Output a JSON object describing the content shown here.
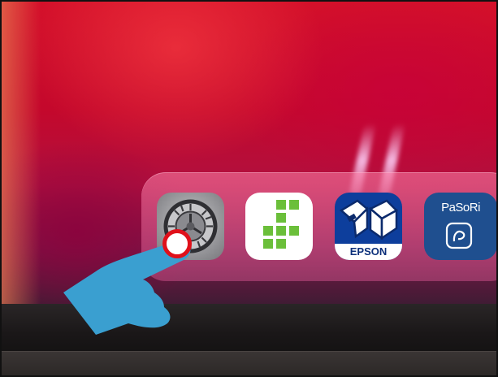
{
  "dock": {
    "apps": [
      {
        "name": "settings",
        "label": ""
      },
      {
        "name": "grid-app",
        "label": ""
      },
      {
        "name": "epson",
        "label": "EPSON"
      },
      {
        "name": "pasori",
        "label": "PaSoRi"
      }
    ]
  },
  "colors": {
    "wallpaper": "#c4082c",
    "dock": "#e0709c",
    "settings_gray": "#8f8f93",
    "grid_green": "#6bbf3a",
    "epson_blue": "#0d3e9c",
    "pasori_blue": "#1f4f8f",
    "pointer": "#3a9fd0",
    "touch_ring": "#e0101a"
  },
  "annotation": {
    "icon": "hand-pointer-icon",
    "target": "settings"
  }
}
